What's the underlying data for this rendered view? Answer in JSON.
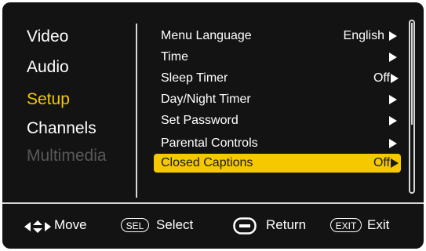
{
  "left_menu": {
    "items": [
      {
        "label": "Video",
        "state": "normal"
      },
      {
        "label": "Audio",
        "state": "normal"
      },
      {
        "label": "Setup",
        "state": "active"
      },
      {
        "label": "Channels",
        "state": "normal"
      },
      {
        "label": "Multimedia",
        "state": "disabled"
      }
    ]
  },
  "submenu": {
    "items": [
      {
        "label": "Menu Language",
        "value": "English",
        "selected": false
      },
      {
        "label": "Time",
        "value": "",
        "selected": false
      },
      {
        "label": "Sleep Timer",
        "value": "Off",
        "selected": false
      },
      {
        "label": "Day/Night Timer",
        "value": "",
        "selected": false
      },
      {
        "label": "Set Password",
        "value": "",
        "selected": false
      },
      {
        "label": "Parental Controls",
        "value": "",
        "selected": false
      },
      {
        "label": "Closed Captions",
        "value": "Off",
        "selected": true
      }
    ]
  },
  "footer": {
    "move_label": "Move",
    "sel_badge": "SEL",
    "select_label": "Select",
    "return_label": "Return",
    "exit_badge": "EXIT",
    "exit_label": "Exit"
  },
  "colors": {
    "background": "#131313",
    "accent": "#f5c800",
    "text": "#ffffff",
    "disabled": "#585858"
  },
  "icons": [
    "move-arrows-icon",
    "return-button-icon",
    "submenu-arrow-icon"
  ]
}
